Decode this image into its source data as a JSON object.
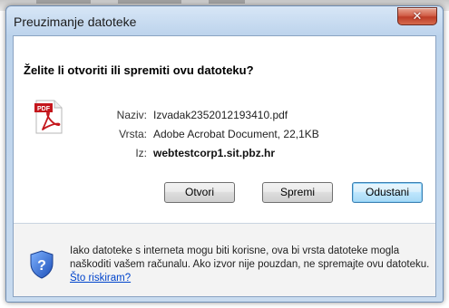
{
  "dialog": {
    "title": "Preuzimanje datoteke",
    "close_symbol": "✕",
    "question": "Želite li otvoriti ili spremiti ovu datoteku?",
    "file_icon": "pdf-icon",
    "fields": {
      "name_label": "Naziv:",
      "name_value": "Izvadak2352012193410.pdf",
      "type_label": "Vrsta:",
      "type_value": "Adobe Acrobat Document, 22,1KB",
      "from_label": "Iz:",
      "from_value": "webtestcorp1.sit.pbz.hr"
    },
    "buttons": {
      "open": "Otvori",
      "save": "Spremi",
      "cancel": "Odustani"
    },
    "warning": {
      "icon": "shield-question-icon",
      "text": "Iako datoteke s interneta mogu biti korisne, ova bi vrsta datoteke mogla naškoditi vašem računalu. Ako izvor nije pouzdan, ne spremajte ovu datoteku.",
      "link": "Što riskiram?"
    }
  },
  "colors": {
    "window_frame": "#bcd3ec",
    "close_button": "#c8452d",
    "link": "#0044cc"
  }
}
